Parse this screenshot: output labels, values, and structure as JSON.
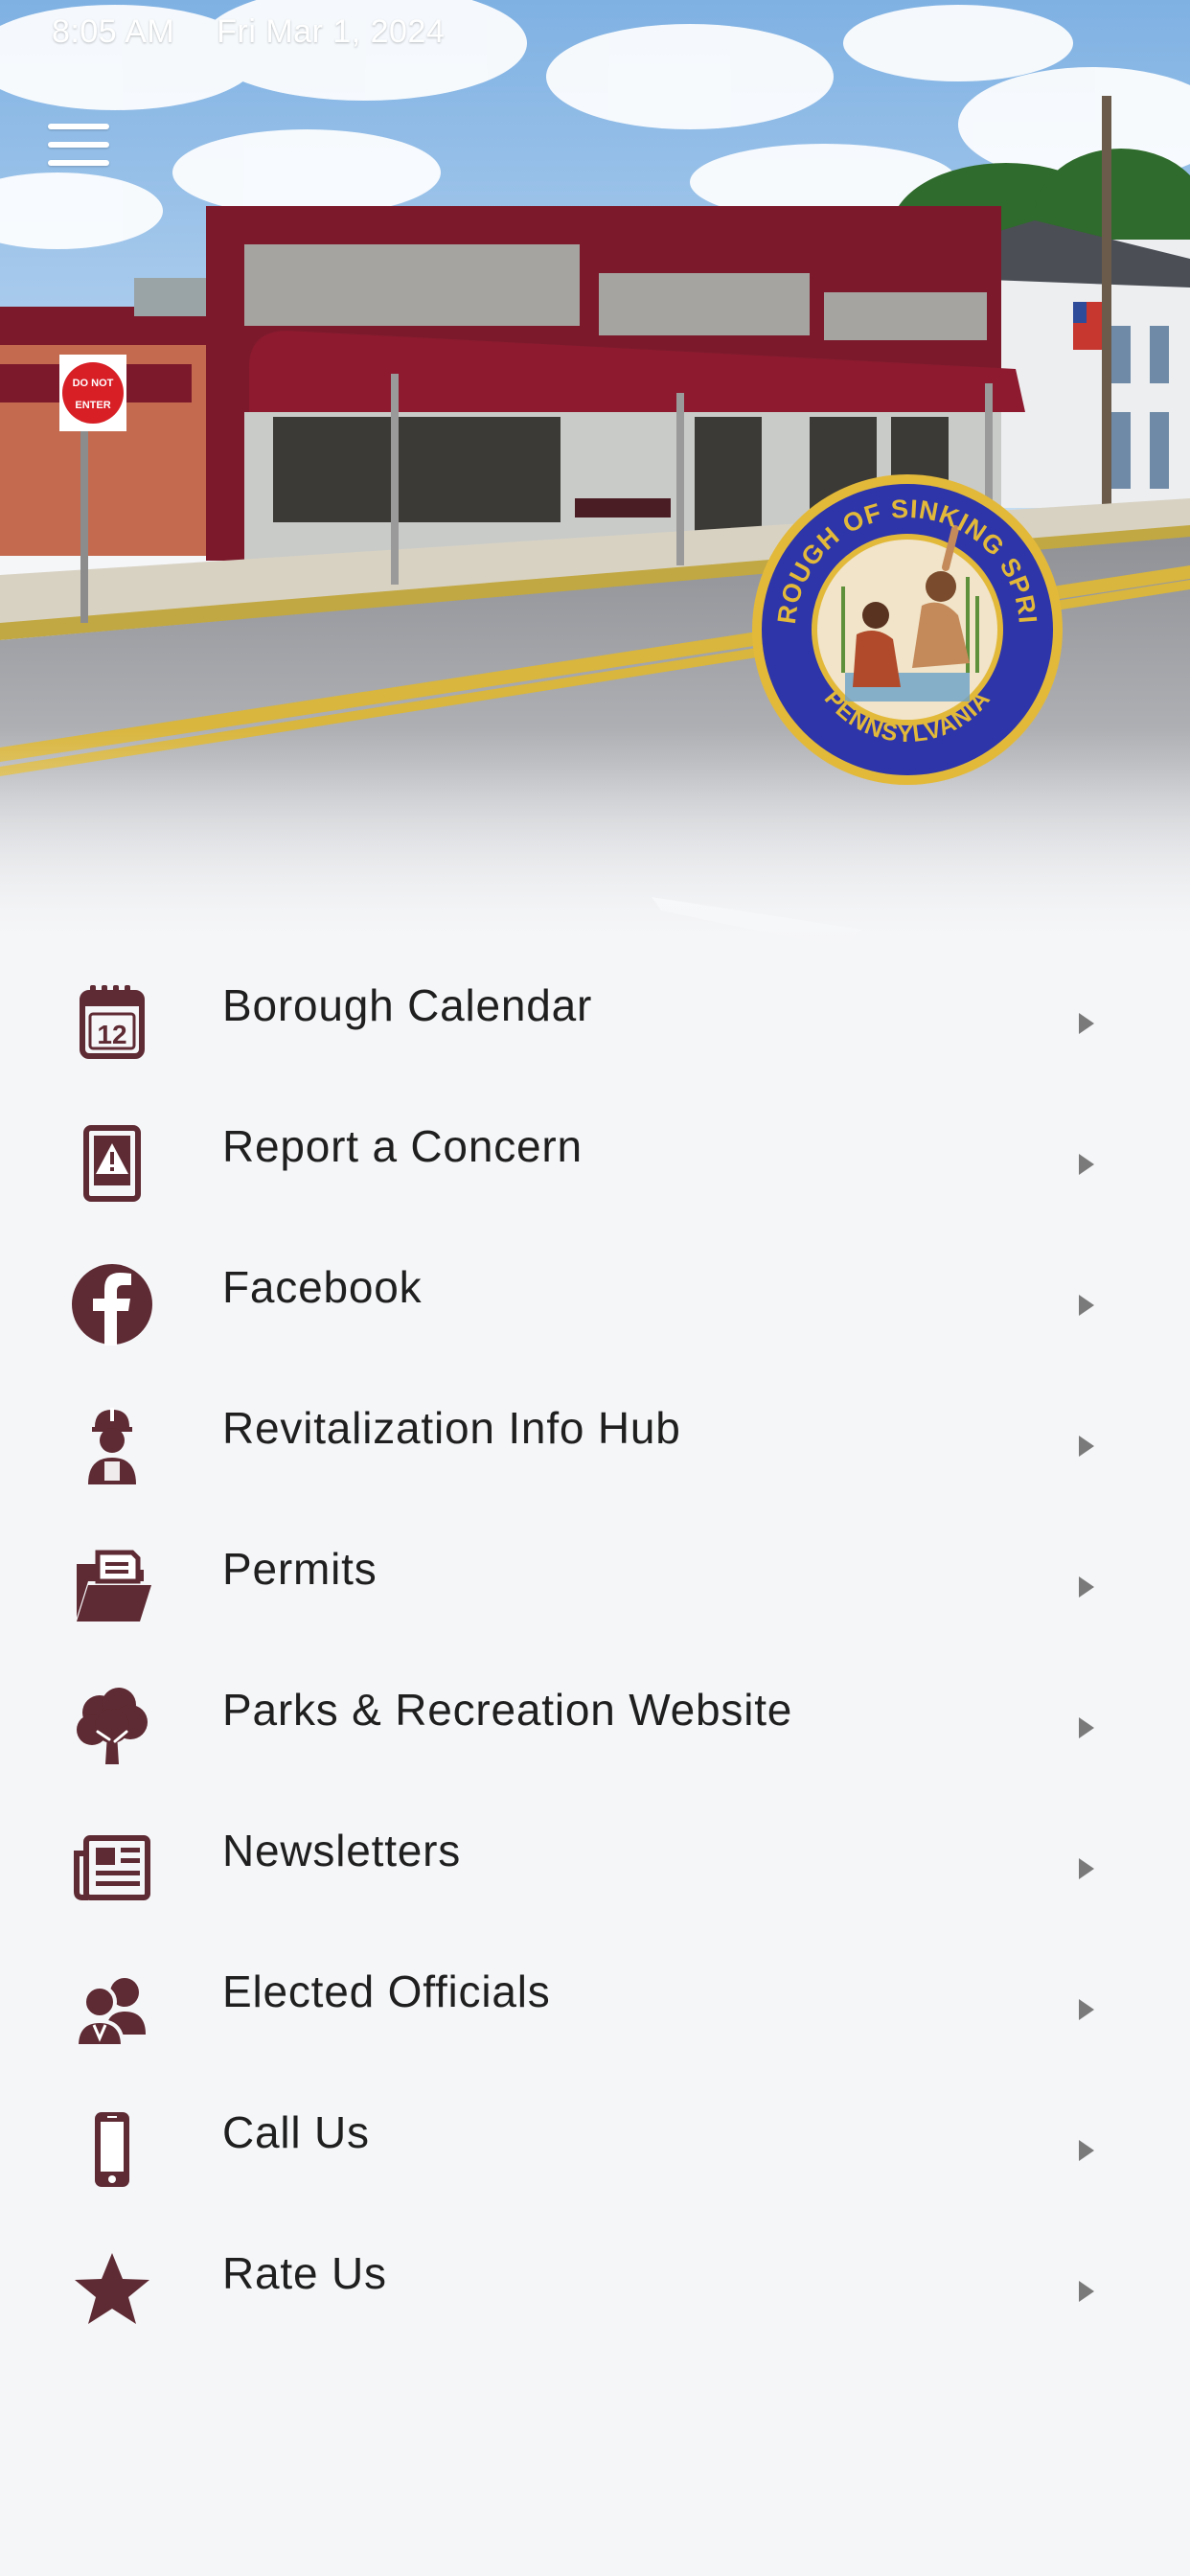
{
  "status_bar": {
    "time": "8:05 AM",
    "date": "Fri Mar 1, 2024"
  },
  "header": {
    "menu_icon": "hamburger-menu-icon"
  },
  "seal": {
    "top_text": "BOROUGH OF SINKING SPRING",
    "bottom_text": "PENNSYLVANIA"
  },
  "sign": {
    "line1": "DO NOT",
    "line2": "ENTER"
  },
  "colors": {
    "accent": "#5e2a33",
    "background": "#f5f6f8",
    "text": "#1f1f1f",
    "chevron": "#7a7a7a",
    "building_trim": "#7c1a2c"
  },
  "menu": {
    "items": [
      {
        "label": "Borough Calendar",
        "icon": "calendar-icon"
      },
      {
        "label": "Report a Concern",
        "icon": "report-warning-icon"
      },
      {
        "label": "Facebook",
        "icon": "facebook-icon"
      },
      {
        "label": "Revitalization Info Hub",
        "icon": "construction-worker-icon"
      },
      {
        "label": "Permits",
        "icon": "folder-document-icon"
      },
      {
        "label": "Parks & Recreation Website",
        "icon": "tree-icon"
      },
      {
        "label": "Newsletters",
        "icon": "newspaper-icon"
      },
      {
        "label": "Elected Officials",
        "icon": "users-icon"
      },
      {
        "label": "Call Us",
        "icon": "mobile-phone-icon"
      },
      {
        "label": "Rate Us",
        "icon": "star-icon"
      }
    ]
  }
}
